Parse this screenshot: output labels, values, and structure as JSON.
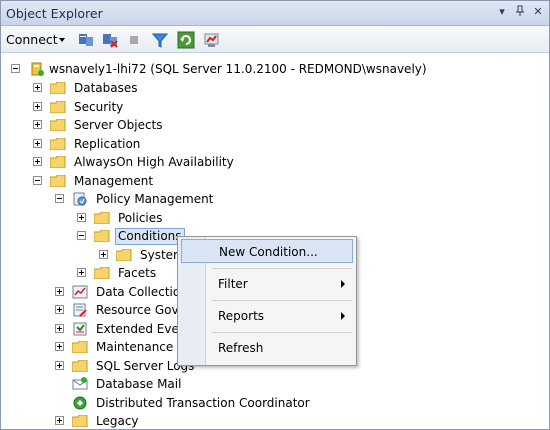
{
  "window": {
    "title": "Object Explorer"
  },
  "toolbar": {
    "connect_label": "Connect"
  },
  "tree": {
    "server": "wsnavely1-lhi72 (SQL Server 11.0.2100 - REDMOND\\wsnavely)",
    "databases": "Databases",
    "security": "Security",
    "server_objects": "Server Objects",
    "replication": "Replication",
    "alwayson": "AlwaysOn High Availability",
    "management": "Management",
    "policy_management": "Policy Management",
    "policies": "Policies",
    "conditions": "Conditions",
    "system": "Syster",
    "facets": "Facets",
    "data_collection": "Data Collection",
    "resource_governor": "Resource Gove",
    "extended_events": "Extended Even",
    "maintenance_plans": "Maintenance P",
    "sql_server_logs": "SQL Server Logs",
    "database_mail": "Database Mail",
    "dtc": "Distributed Transaction Coordinator",
    "legacy": "Legacy"
  },
  "context_menu": {
    "new_condition": "New Condition...",
    "filter": "Filter",
    "reports": "Reports",
    "refresh": "Refresh"
  }
}
